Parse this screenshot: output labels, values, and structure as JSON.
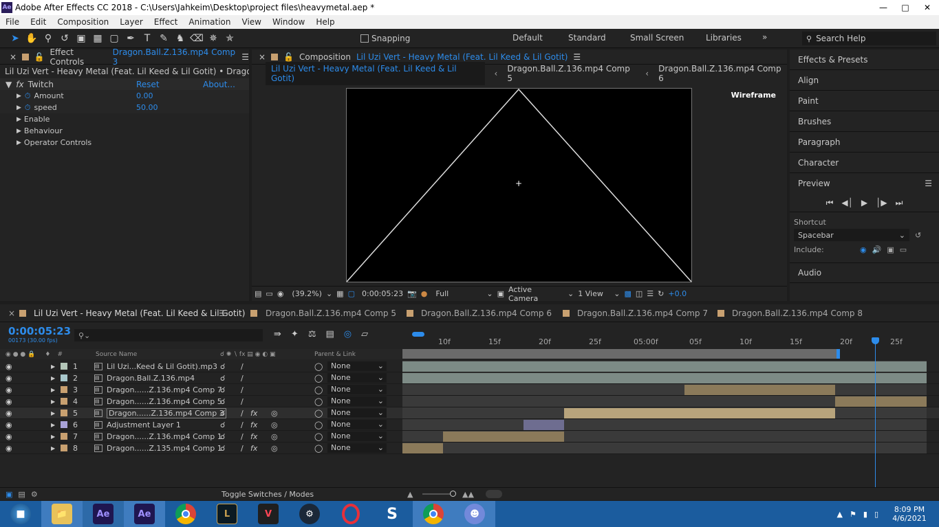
{
  "window": {
    "title": "Adobe After Effects CC 2018 - C:\\Users\\Jahkeim\\Desktop\\project files\\heavymetal.aep *",
    "logo": "Ae"
  },
  "menu": [
    "File",
    "Edit",
    "Composition",
    "Layer",
    "Effect",
    "Animation",
    "View",
    "Window",
    "Help"
  ],
  "toolbar": {
    "snapping": "Snapping",
    "workspaces": [
      "Default",
      "Standard",
      "Small Screen",
      "Libraries"
    ],
    "search": "Search Help"
  },
  "effects": {
    "tab": "Effect Controls",
    "tab_file": "Dragon.Ball.Z.136.mp4 Comp 3",
    "breadcrumb": "Lil Uzi Vert - Heavy Metal (Feat. Lil Keed & Lil Gotit) • Dragon.Ball.Z.136",
    "effect_name": "Twitch",
    "reset": "Reset",
    "about": "About...",
    "params": [
      {
        "label": "Amount",
        "value": "0.00"
      },
      {
        "label": "speed",
        "value": "50.00"
      }
    ],
    "groups": [
      "Enable",
      "Behaviour",
      "Operator Controls"
    ]
  },
  "composition": {
    "tab": "Composition",
    "tab_name": "Lil Uzi Vert - Heavy Metal (Feat. Lil Keed & Lil Gotit)",
    "crumbs": [
      "Lil Uzi Vert - Heavy Metal (Feat. Lil Keed & Lil Gotit)",
      "Dragon.Ball.Z.136.mp4 Comp 5",
      "Dragon.Ball.Z.136.mp4 Comp 6"
    ],
    "overlay": "Wireframe",
    "footer": {
      "zoom": "(39.2%)",
      "time": "0:00:05:23",
      "resolution": "Full",
      "camera": "Active Camera",
      "views": "1 View",
      "exposure": "+0.0"
    }
  },
  "right_panel": {
    "items": [
      "Effects & Presets",
      "Align",
      "Paint",
      "Brushes",
      "Paragraph",
      "Character"
    ],
    "preview": "Preview",
    "shortcut_label": "Shortcut",
    "shortcut_value": "Spacebar",
    "include": "Include:",
    "audio": "Audio"
  },
  "timeline": {
    "tabs": [
      "Lil Uzi Vert - Heavy Metal (Feat. Lil Keed & Lil Gotit)",
      "Dragon.Ball.Z.136.mp4 Comp 5",
      "Dragon.Ball.Z.136.mp4 Comp 6",
      "Dragon.Ball.Z.136.mp4 Comp 7",
      "Dragon.Ball.Z.136.mp4 Comp 8"
    ],
    "timecode": "0:00:05:23",
    "frames": "00173 (30.00 fps)",
    "col_source": "Source Name",
    "col_parent": "Parent & Link",
    "ruler": [
      "10f",
      "15f",
      "20f",
      "25f",
      "05:00f",
      "05f",
      "10f",
      "15f",
      "20f",
      "25f"
    ],
    "layers": [
      {
        "num": "1",
        "name": "Lil Uzi...Keed & Lil Gotit).mp3",
        "parent": "None",
        "label": "#b4c6b8",
        "fx": false,
        "start": 0.0,
        "end": 1.0
      },
      {
        "num": "2",
        "name": "Dragon.Ball.Z.136.mp4",
        "parent": "None",
        "label": "#a8c8cc",
        "fx": false,
        "start": 0.0,
        "end": 1.0
      },
      {
        "num": "3",
        "name": "Dragon......Z.136.mp4 Comp 7",
        "parent": "None",
        "label": "#c8a070",
        "fx": false,
        "start": 0.538,
        "end": 0.826
      },
      {
        "num": "4",
        "name": "Dragon......Z.136.mp4 Comp 5",
        "parent": "None",
        "label": "#c8a070",
        "fx": false,
        "start": 0.826,
        "end": 1.0
      },
      {
        "num": "5",
        "name": "Dragon......Z.136.mp4 Comp 3",
        "parent": "None",
        "label": "#c8a070",
        "fx": true,
        "start": 0.308,
        "end": 0.826
      },
      {
        "num": "6",
        "name": "Adjustment Layer 1",
        "parent": "None",
        "label": "#a9a3d8",
        "fx": true,
        "start": 0.231,
        "end": 0.308
      },
      {
        "num": "7",
        "name": "Dragon......Z.136.mp4 Comp 1",
        "parent": "None",
        "label": "#c8a070",
        "fx": true,
        "start": 0.077,
        "end": 0.308
      },
      {
        "num": "8",
        "name": "Dragon......Z.135.mp4 Comp 1",
        "parent": "None",
        "label": "#c8a070",
        "fx": true,
        "start": 0.0,
        "end": 0.077
      }
    ],
    "footer": "Toggle Switches / Modes"
  },
  "taskbar": {
    "time": "8:09 PM",
    "date": "4/6/2021"
  }
}
